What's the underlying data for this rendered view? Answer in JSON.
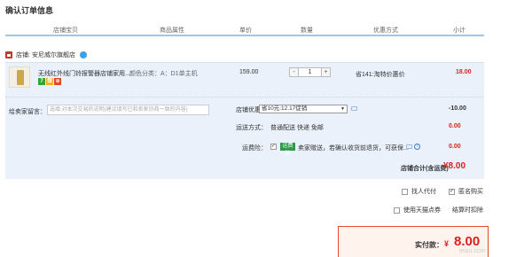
{
  "page_title": "确认订单信息",
  "columns": [
    "店铺宝贝",
    "商品属性",
    "单价",
    "数量",
    "优惠方式",
    "小计"
  ],
  "shop": {
    "label": "店铺:",
    "name": "安尼威尔旗舰店"
  },
  "item": {
    "title": "无线红外线门铃报警器店铺家用...",
    "attribute": "颜色分类：A：D1单主机",
    "tags": [
      "7",
      "保",
      "⊕"
    ],
    "price": "159.00",
    "quantity": "1",
    "minus": "-",
    "plus": "+",
    "promotion": "省141:淘特价惠价",
    "subtotal": "18.00"
  },
  "message": {
    "label": "给卖家留言：",
    "placeholder": "选填:对本次交易的说明(建议填写已和卖家协商一致的内容)"
  },
  "shop_coupon": {
    "label": "店铺优惠：",
    "selected": "省10元:12.17促销",
    "value": "-10.00"
  },
  "shipping": {
    "label": "运送方式：",
    "text": "普通配送 快递 免邮",
    "value": "0.00"
  },
  "insurance": {
    "label": "运费险：",
    "checked": "✓",
    "badge": "运费险",
    "text": "卖家赠送，若确认收货前退货，可获保...",
    "value": "0.00"
  },
  "shop_total": {
    "label": "店铺合计(含运费)",
    "value": "¥8.00"
  },
  "options": {
    "proxy_pay": "找人代付",
    "anonymous": "匿名购买",
    "anonymous_checked": "✓",
    "tmall_points": "使用天猫点券",
    "settlement_discount": "结算时扣除"
  },
  "payment": {
    "label": "实付款：",
    "currency": "¥",
    "amount": "8.00"
  },
  "watermark": "leizu.com"
}
